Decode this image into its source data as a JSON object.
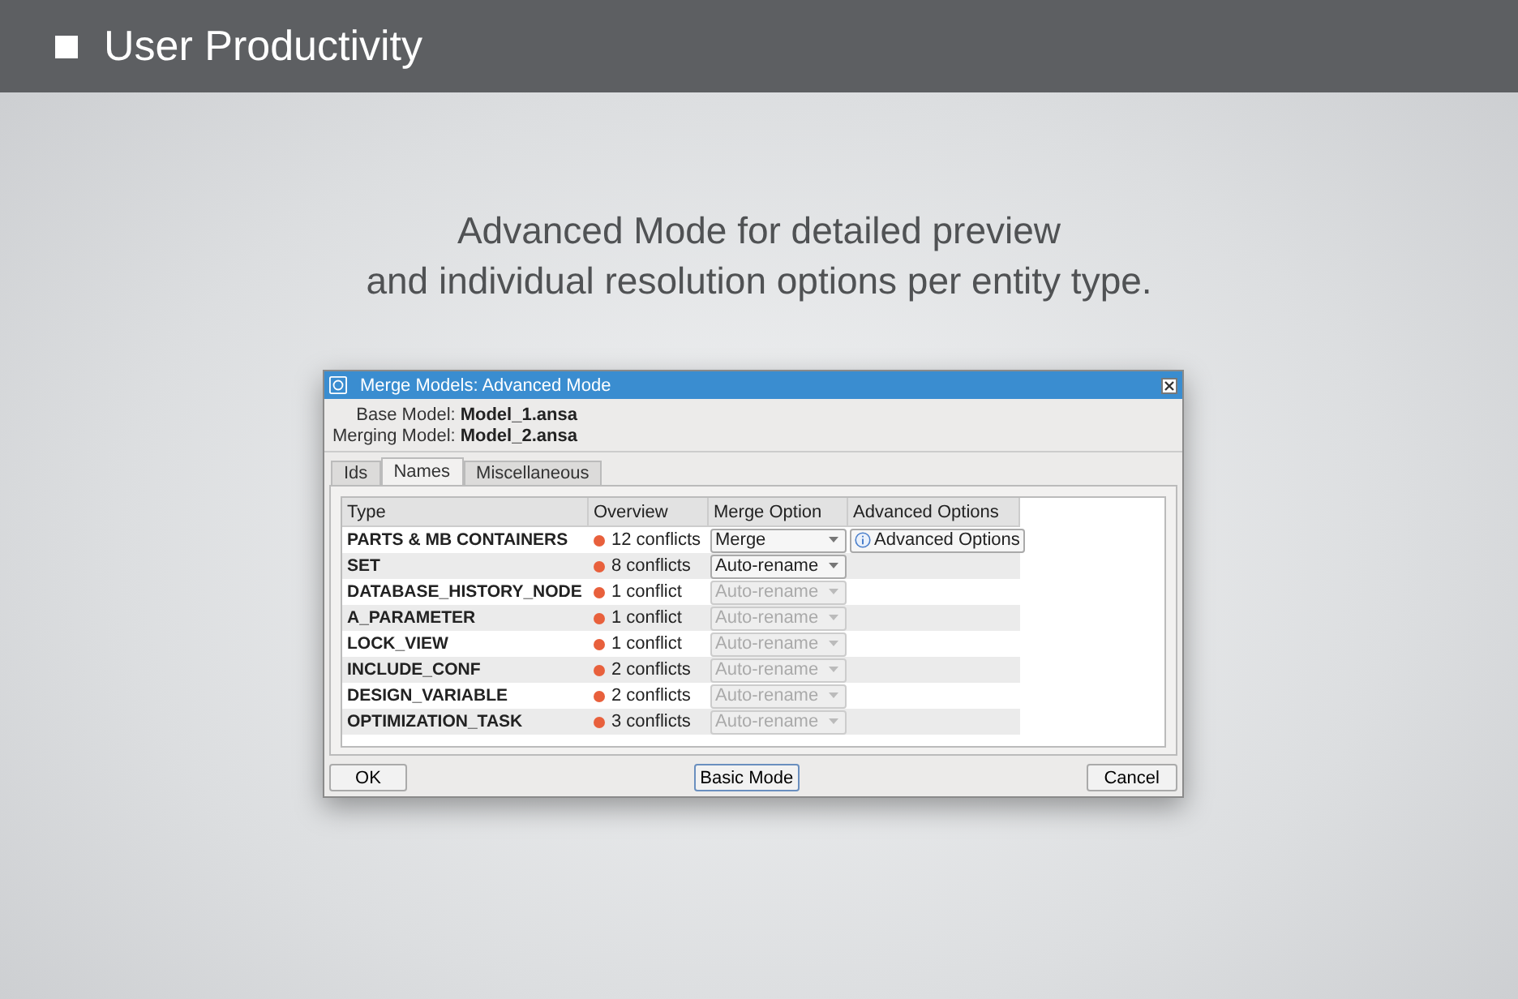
{
  "header": {
    "title": "User Productivity"
  },
  "subtitle": [
    "Advanced Mode for detailed preview",
    "and individual resolution options per entity type."
  ],
  "dialog": {
    "title": "Merge Models: Advanced Mode",
    "models": [
      {
        "label": "Base Model:",
        "value": "Model_1.ansa"
      },
      {
        "label": "Merging Model:",
        "value": "Model_2.ansa"
      }
    ],
    "tabs": [
      {
        "label": "Ids",
        "selected": false
      },
      {
        "label": "Names",
        "selected": true
      },
      {
        "label": "Miscellaneous",
        "selected": false
      }
    ],
    "table": {
      "columns": [
        "Type",
        "Overview",
        "Merge Option",
        "Advanced Options"
      ],
      "rows": [
        {
          "type": "PARTS & MB CONTAINERS",
          "overview": "12 conflicts",
          "color": "#e8603c",
          "merge_option": "Merge",
          "disabled": false,
          "advanced_option": "Advanced Options"
        },
        {
          "type": "SET",
          "overview": "8 conflicts",
          "color": "#e8603c",
          "merge_option": "Auto-rename",
          "disabled": false
        },
        {
          "type": "DATABASE_HISTORY_NODE",
          "overview": "1 conflict",
          "color": "#e8603c",
          "merge_option": "Auto-rename",
          "disabled": true
        },
        {
          "type": "A_PARAMETER",
          "overview": "1 conflict",
          "color": "#e8603c",
          "merge_option": "Auto-rename",
          "disabled": true
        },
        {
          "type": "LOCK_VIEW",
          "overview": "1 conflict",
          "color": "#e8603c",
          "merge_option": "Auto-rename",
          "disabled": true
        },
        {
          "type": "INCLUDE_CONF",
          "overview": "2 conflicts",
          "color": "#e8603c",
          "merge_option": "Auto-rename",
          "disabled": true
        },
        {
          "type": "DESIGN_VARIABLE",
          "overview": "2 conflicts",
          "color": "#e8603c",
          "merge_option": "Auto-rename",
          "disabled": true
        },
        {
          "type": "OPTIMIZATION_TASK",
          "overview": "3 conflicts",
          "color": "#e8603c",
          "merge_option": "Auto-rename",
          "disabled": true
        }
      ]
    },
    "buttons": [
      "OK",
      "Basic Mode",
      "Cancel"
    ]
  }
}
